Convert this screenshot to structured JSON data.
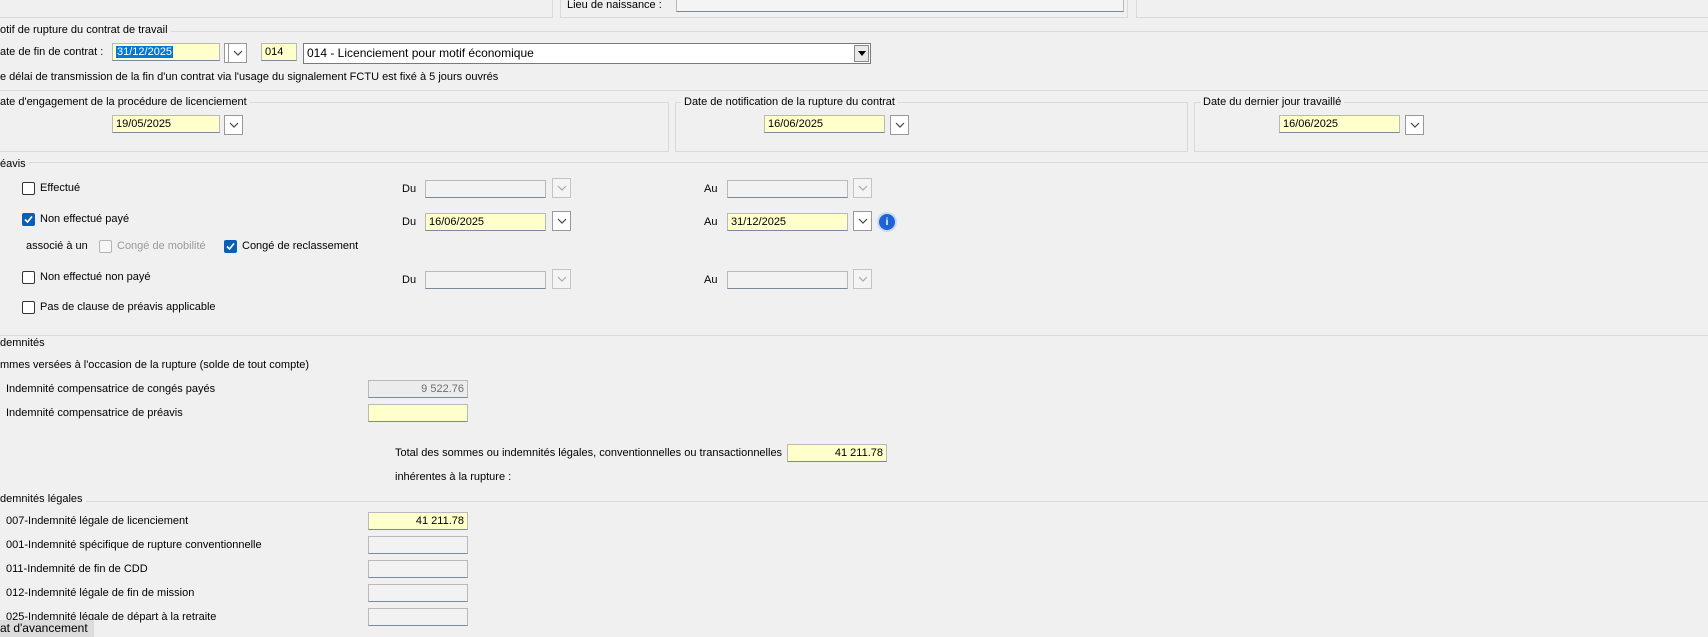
{
  "top": {
    "lieu_naissance_label": "Lieu de naissance :"
  },
  "motif": {
    "group_title": "otif de rupture du contrat de travail",
    "date_fin_label": "ate de fin de contrat :",
    "date_fin_value": "31/12/2025",
    "code_value": "014",
    "motif_selected": "014 - Licenciement pour motif économique",
    "fctu_note": "e délai de transmission de la fin d'un contrat via l'usage du signalement FCTU est fixé à 5 jours ouvrés"
  },
  "dates": {
    "engagement_title": "ate d'engagement de la procédure de licenciement",
    "engagement_value": "19/05/2025",
    "notification_title": "Date de notification de la rupture du contrat",
    "notification_value": "16/06/2025",
    "dernier_jour_title": "Date du dernier jour travaillé",
    "dernier_jour_value": "16/06/2025"
  },
  "preavis": {
    "group_title": "éavis",
    "du_label": "Du",
    "au_label": "Au",
    "effectue": {
      "label": "Effectué",
      "checked": false,
      "du": "",
      "au": ""
    },
    "non_effectue_paye": {
      "label": "Non effectué payé",
      "checked": true,
      "du": "16/06/2025",
      "au": "31/12/2025"
    },
    "associe_label": "associé à un",
    "conge_mobilite": {
      "label": "Congé de mobilité",
      "checked": false
    },
    "conge_reclassement": {
      "label": "Congé de reclassement",
      "checked": true
    },
    "non_effectue_non_paye": {
      "label": "Non effectué non payé",
      "checked": false,
      "du": "",
      "au": ""
    },
    "pas_de_clause": {
      "label": "Pas de clause de préavis applicable",
      "checked": false
    }
  },
  "indemnites": {
    "group_title": "demnités",
    "sommes_title": "mmes versées à l'occasion de la rupture (solde de tout compte)",
    "conges_payes_label": "Indemnité compensatrice de congés payés",
    "conges_payes_value": "9 522.76",
    "preavis_label": "Indemnité compensatrice de préavis",
    "preavis_value": "",
    "total_label_line1": "Total des sommes ou indemnités légales, conventionnelles ou transactionnelles",
    "total_label_line2": "inhérentes à la rupture :",
    "total_value": "41 211.78"
  },
  "legales": {
    "group_title": "demnités légales",
    "rows": [
      {
        "label": "007-Indemnité légale de licenciement",
        "value": "41 211.78"
      },
      {
        "label": "001-Indemnité spécifique de rupture conventionnelle",
        "value": ""
      },
      {
        "label": "011-Indemnité de fin de CDD",
        "value": ""
      },
      {
        "label": "012-Indemnité légale de fin de mission",
        "value": ""
      },
      {
        "label": "025-Indemnité légale de départ à la retraite",
        "value": ""
      }
    ]
  },
  "status": {
    "text": "at d'avancement"
  }
}
